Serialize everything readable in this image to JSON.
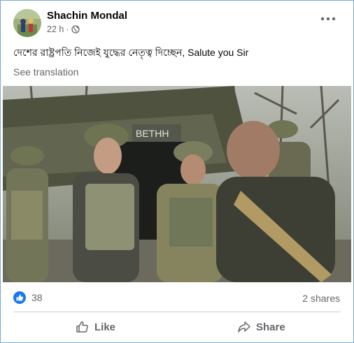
{
  "post": {
    "author": "Shachin Mondal",
    "time": "22 h",
    "separator": "·",
    "text": "দেশের রাষ্ট্রপতি নিজেই যুদ্ধের নেতৃত্ব দিচ্ছেন, Salute you Sir",
    "see_translation": "See translation"
  },
  "photo": {
    "sign_text": "BETHH"
  },
  "stats": {
    "like_count": "38",
    "shares": "2 shares"
  },
  "actions": {
    "like_label": "Like",
    "share_label": "Share"
  },
  "colors": {
    "like_blue": "#1877f2",
    "muted": "#65676b",
    "divider": "#ced0d4",
    "frame": "#7aa7d9"
  }
}
